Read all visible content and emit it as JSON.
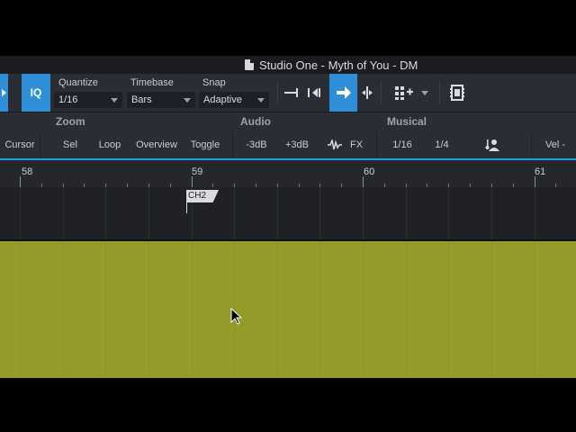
{
  "window": {
    "title": "Studio One - Myth of You - DM"
  },
  "toolbar": {
    "iq_label": "IQ",
    "quantize": {
      "label": "Quantize",
      "value": "1/16"
    },
    "timebase": {
      "label": "Timebase",
      "value": "Bars"
    },
    "snap": {
      "label": "Snap",
      "value": "Adaptive"
    }
  },
  "zoom_row": {
    "zoom_label": "Zoom",
    "audio_label": "Audio",
    "musical_label": "Musical",
    "buttons": {
      "cursor": "Cursor",
      "sel": "Sel",
      "loop": "Loop",
      "overview": "Overview",
      "toggle": "Toggle",
      "minus3db": "-3dB",
      "plus3db": "+3dB",
      "fx": "FX",
      "q116": "1/16",
      "q14": "1/4",
      "vel": "Vel -"
    }
  },
  "ruler": {
    "bars": [
      "58",
      "59",
      "60",
      "61"
    ]
  },
  "marker": {
    "label": "CH2"
  },
  "colors": {
    "accent": "#2e8fd8",
    "event": "#959b28",
    "ruler_line": "#1aa0d8"
  }
}
